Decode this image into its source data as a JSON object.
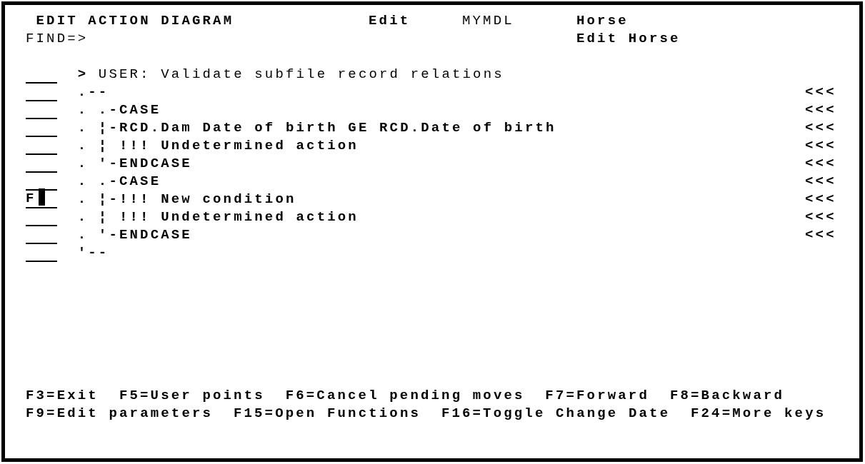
{
  "header": {
    "title": "EDIT ACTION DIAGRAM",
    "mode": "Edit",
    "model": "MYMDL",
    "object": "Horse",
    "function": "Edit Horse",
    "find_prompt": "FIND=>"
  },
  "lines": [
    {
      "kind": "user_point",
      "text": "**>** USER: Validate subfile record relations",
      "focused": false
    },
    {
      "kind": "statement",
      "text": ".--",
      "end_mark": "<<<",
      "focused": false
    },
    {
      "kind": "statement",
      "text": ". .-CASE",
      "end_mark": "<<<",
      "focused": false
    },
    {
      "kind": "statement",
      "text": ". ¦-RCD.Dam Date of birth GE RCD.Date of birth",
      "end_mark": "<<<",
      "focused": false
    },
    {
      "kind": "statement",
      "text": ". ¦ !!! Undetermined action",
      "end_mark": "<<<",
      "focused": false
    },
    {
      "kind": "statement",
      "text": ". '-ENDCASE",
      "end_mark": "<<<",
      "focused": false
    },
    {
      "kind": "statement",
      "text": ". .-CASE",
      "end_mark": "<<<",
      "focused": false
    },
    {
      "kind": "statement",
      "command": "F",
      "text": ". ¦-!!! New condition",
      "end_mark": "<<<",
      "focused": true
    },
    {
      "kind": "statement",
      "text": ". ¦ !!! Undetermined action",
      "end_mark": "<<<",
      "focused": false
    },
    {
      "kind": "statement",
      "text": ". '-ENDCASE",
      "end_mark": "<<<",
      "focused": false
    },
    {
      "kind": "statement",
      "text": "'--",
      "focused": false
    }
  ],
  "function_key_lines": [
    {
      "keys": [
        "F3=Exit",
        "F5=User points",
        "F6=Cancel pending moves",
        "F7=Forward",
        "F8=Backward"
      ]
    },
    {
      "keys": [
        "F9=Edit parameters",
        "F15=Open Functions",
        "F16=Toggle Change Date",
        "F24=More keys"
      ]
    }
  ]
}
